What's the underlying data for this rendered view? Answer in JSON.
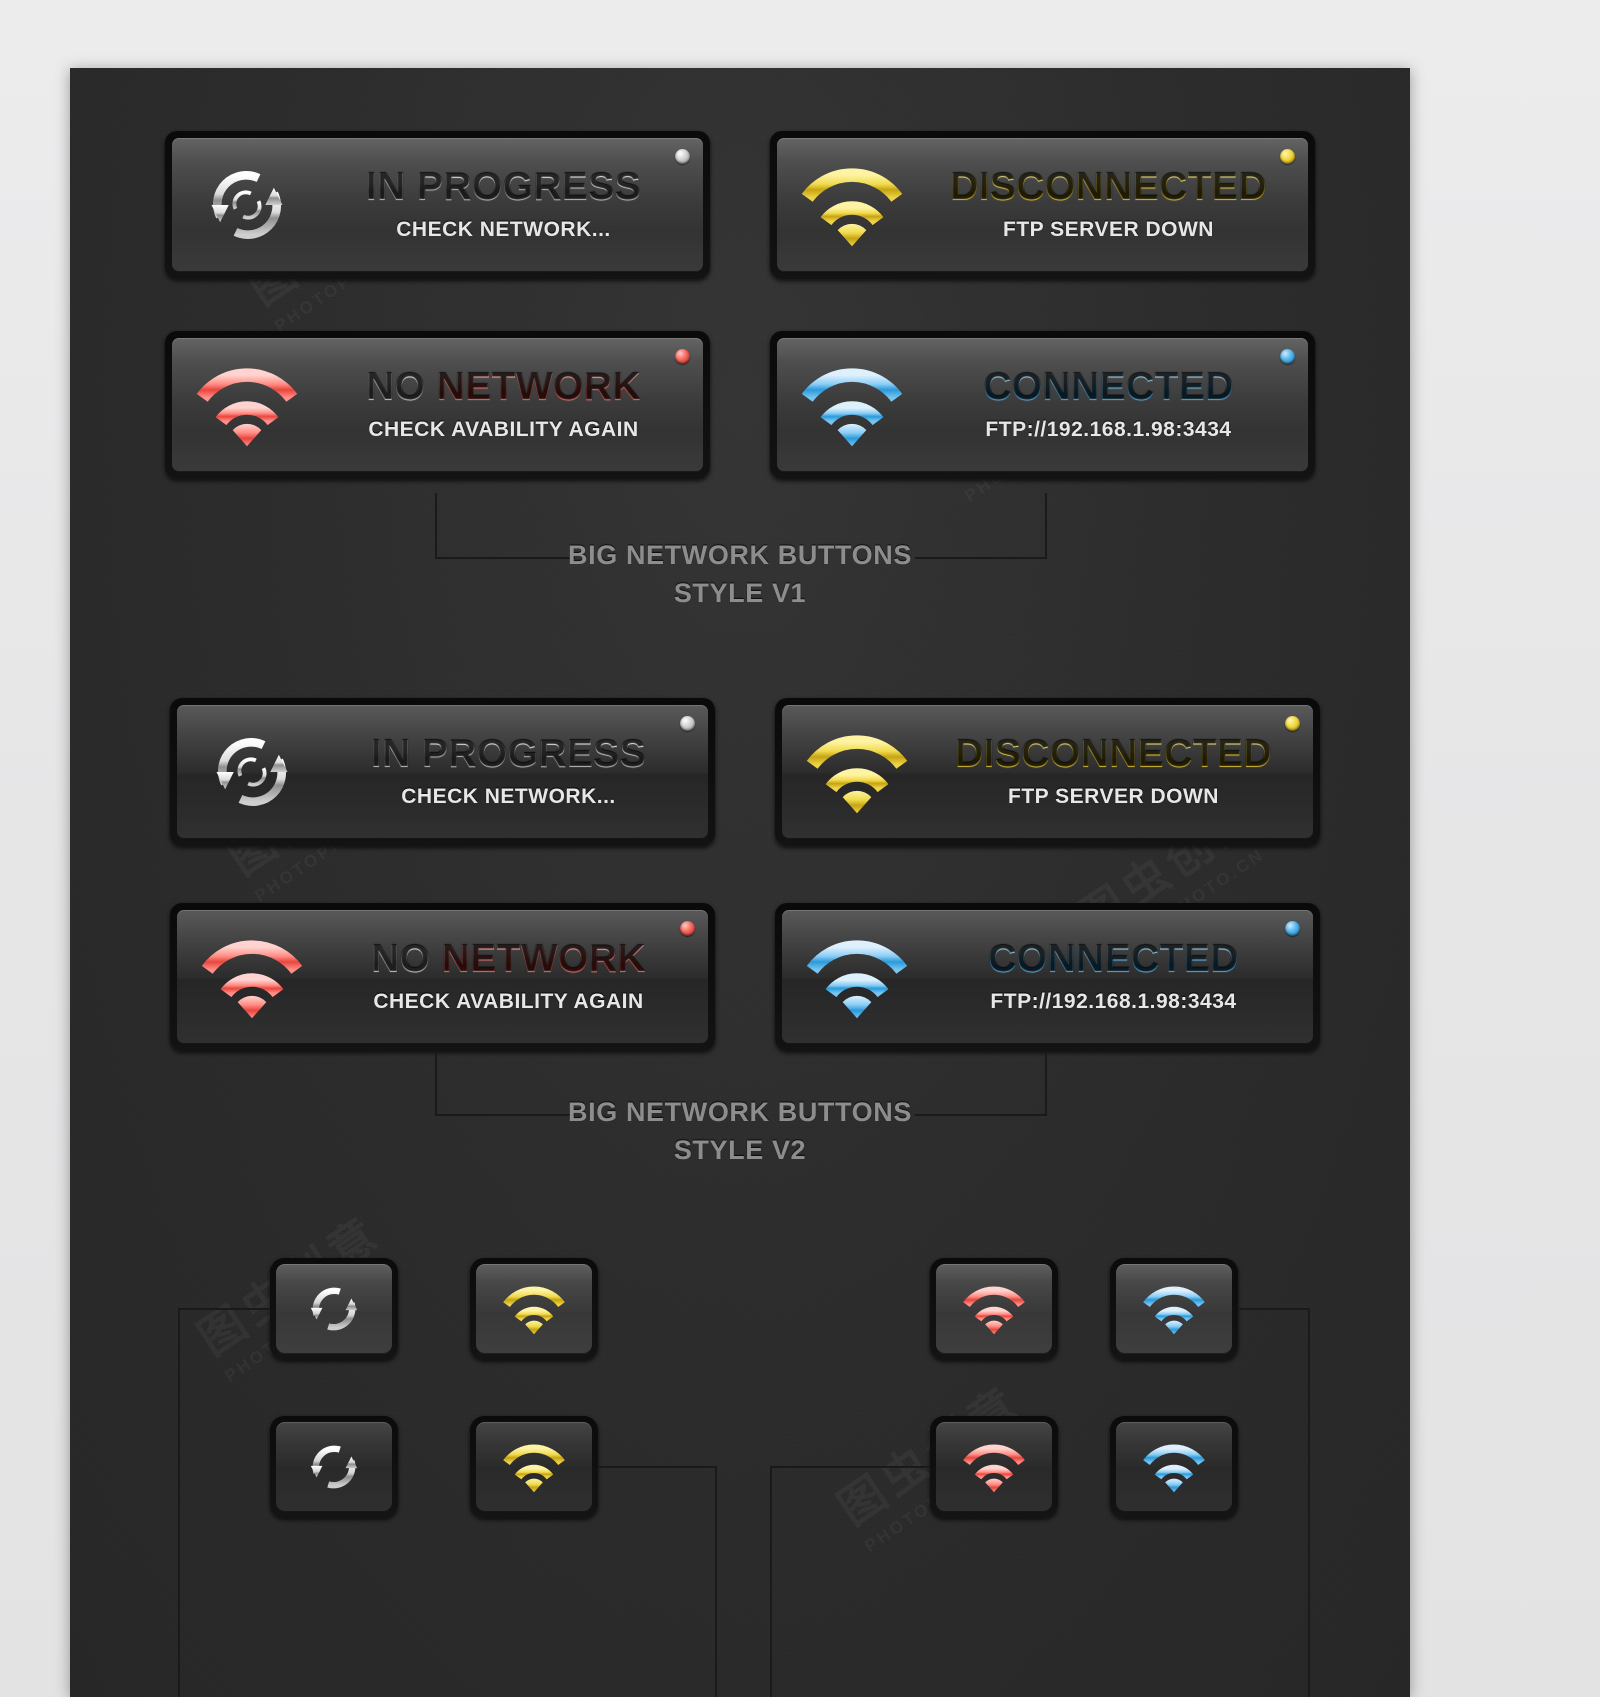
{
  "page": {
    "background_color": "#e8e8e8",
    "panel_color": "#2c2c2c"
  },
  "groups": [
    {
      "label_line1": "BIG NETWORK BUTTONS",
      "label_line2": "STYLE V1"
    },
    {
      "label_line1": "BIG NETWORK BUTTONS",
      "label_line2": "STYLE V2"
    }
  ],
  "big_buttons_v1": [
    {
      "id": "in-progress",
      "icon": "refresh-icon",
      "title": "IN PROGRESS",
      "subtitle": "CHECK NETWORK...",
      "led": "grey",
      "accent": "#d8d8d8"
    },
    {
      "id": "disconnected",
      "icon": "wifi-icon",
      "title": "DISCONNECTED",
      "subtitle": "FTP SERVER DOWN",
      "led": "yellow",
      "accent": "#e8cf3c"
    },
    {
      "id": "no-network",
      "icon": "wifi-icon",
      "title_part1": "NO ",
      "title_part2": "NETWORK",
      "title": "NO NETWORK",
      "subtitle": "CHECK AVABILITY AGAIN",
      "led": "red",
      "accent": "#f4655b"
    },
    {
      "id": "connected",
      "icon": "wifi-icon",
      "title": "CONNECTED",
      "subtitle": "FTP://192.168.1.98:3434",
      "led": "blue",
      "accent": "#52b3ea"
    }
  ],
  "big_buttons_v2": [
    {
      "id": "in-progress",
      "icon": "refresh-icon",
      "title": "IN PROGRESS",
      "subtitle": "CHECK NETWORK...",
      "led": "grey",
      "accent": "#d8d8d8"
    },
    {
      "id": "disconnected",
      "icon": "wifi-icon",
      "title": "DISCONNECTED",
      "subtitle": "FTP SERVER DOWN",
      "led": "yellow",
      "accent": "#e8cf3c"
    },
    {
      "id": "no-network",
      "icon": "wifi-icon",
      "title_part1": "NO ",
      "title_part2": "NETWORK",
      "title": "NO NETWORK",
      "subtitle": "CHECK AVABILITY AGAIN",
      "led": "red",
      "accent": "#f4655b"
    },
    {
      "id": "connected",
      "icon": "wifi-icon",
      "title": "CONNECTED",
      "subtitle": "FTP://192.168.1.98:3434",
      "led": "blue",
      "accent": "#52b3ea"
    }
  ],
  "small_buttons_row1": [
    {
      "id": "refresh-small-v1",
      "icon": "refresh-icon",
      "color": "grey"
    },
    {
      "id": "disconnected-small-v1",
      "icon": "wifi-icon",
      "color": "yellow"
    },
    {
      "id": "no-network-small-v1",
      "icon": "wifi-icon",
      "color": "red"
    },
    {
      "id": "connected-small-v1",
      "icon": "wifi-icon",
      "color": "blue"
    }
  ],
  "small_buttons_row2": [
    {
      "id": "refresh-small-v2",
      "icon": "refresh-icon",
      "color": "grey"
    },
    {
      "id": "disconnected-small-v2",
      "icon": "wifi-icon",
      "color": "yellow"
    },
    {
      "id": "no-network-small-v2",
      "icon": "wifi-icon",
      "color": "red"
    },
    {
      "id": "connected-small-v2",
      "icon": "wifi-icon",
      "color": "blue"
    }
  ],
  "watermark": {
    "cjk": "图虫创意",
    "domain": "PHOTOPHOTO.CN"
  }
}
